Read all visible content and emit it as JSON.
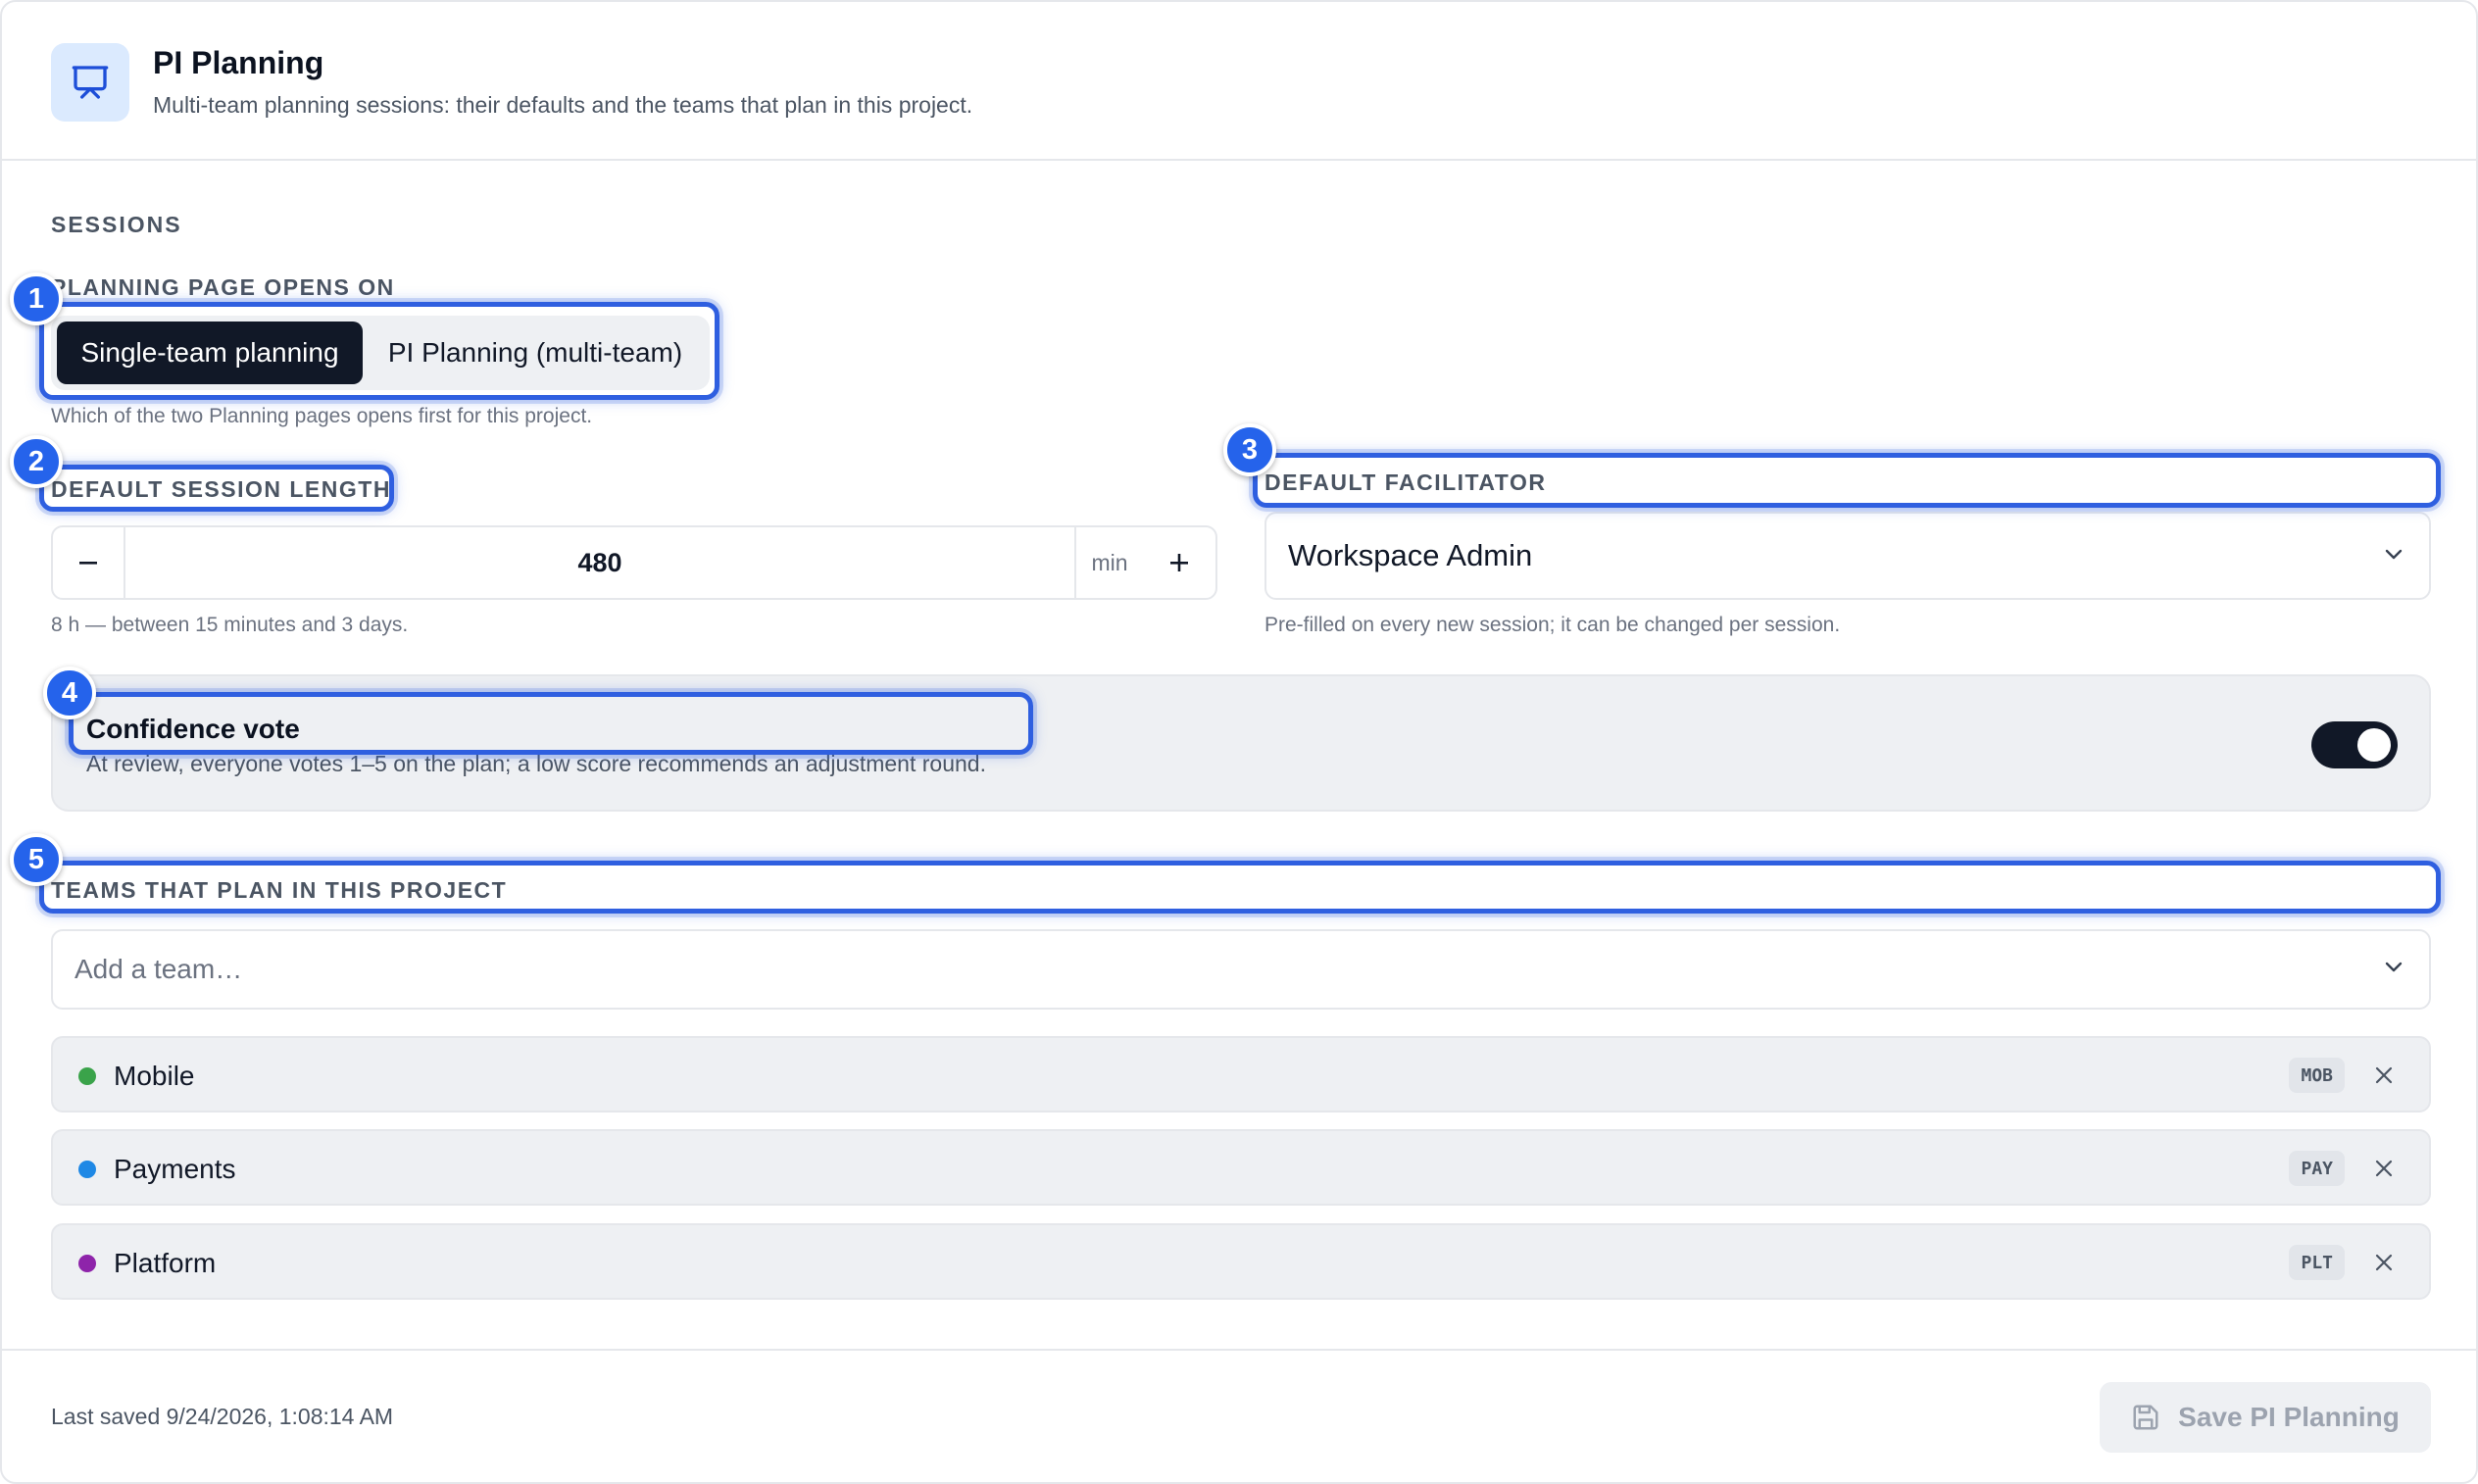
{
  "header": {
    "title": "PI Planning",
    "subtitle": "Multi-team planning sessions: their defaults and the teams that plan in this project.",
    "icon": "presentation-board-icon"
  },
  "sessions": {
    "section_label": "SESSIONS",
    "opens_on": {
      "label": "PLANNING PAGE OPENS ON",
      "options": [
        "Single-team planning",
        "PI Planning (multi-team)"
      ],
      "selected": "Single-team planning",
      "help": "Which of the two Planning pages opens first for this project."
    },
    "session_length": {
      "label": "DEFAULT SESSION LENGTH",
      "value": "480",
      "unit": "min",
      "help": "8 h — between 15 minutes and 3 days."
    },
    "facilitator": {
      "label": "DEFAULT FACILITATOR",
      "value": "Workspace Admin",
      "help": "Pre-filled on every new session; it can be changed per session."
    },
    "confidence_vote": {
      "title": "Confidence vote",
      "description": "At review, everyone votes 1–5 on the plan; a low score recommends an adjustment round.",
      "enabled": true
    }
  },
  "teams": {
    "label": "TEAMS THAT PLAN IN THIS PROJECT",
    "add_placeholder": "Add a team…",
    "items": [
      {
        "name": "Mobile",
        "code": "MOB",
        "color": "#3aa34a"
      },
      {
        "name": "Payments",
        "code": "PAY",
        "color": "#1e88e5"
      },
      {
        "name": "Platform",
        "code": "PLT",
        "color": "#8e24aa"
      }
    ]
  },
  "footer": {
    "last_saved": "Last saved 9/24/2026, 1:08:14 AM",
    "save_label": "Save PI Planning"
  },
  "annotations": [
    "1",
    "2",
    "3",
    "4",
    "5"
  ],
  "colors": {
    "accent": "#2563eb",
    "dark": "#111827"
  }
}
